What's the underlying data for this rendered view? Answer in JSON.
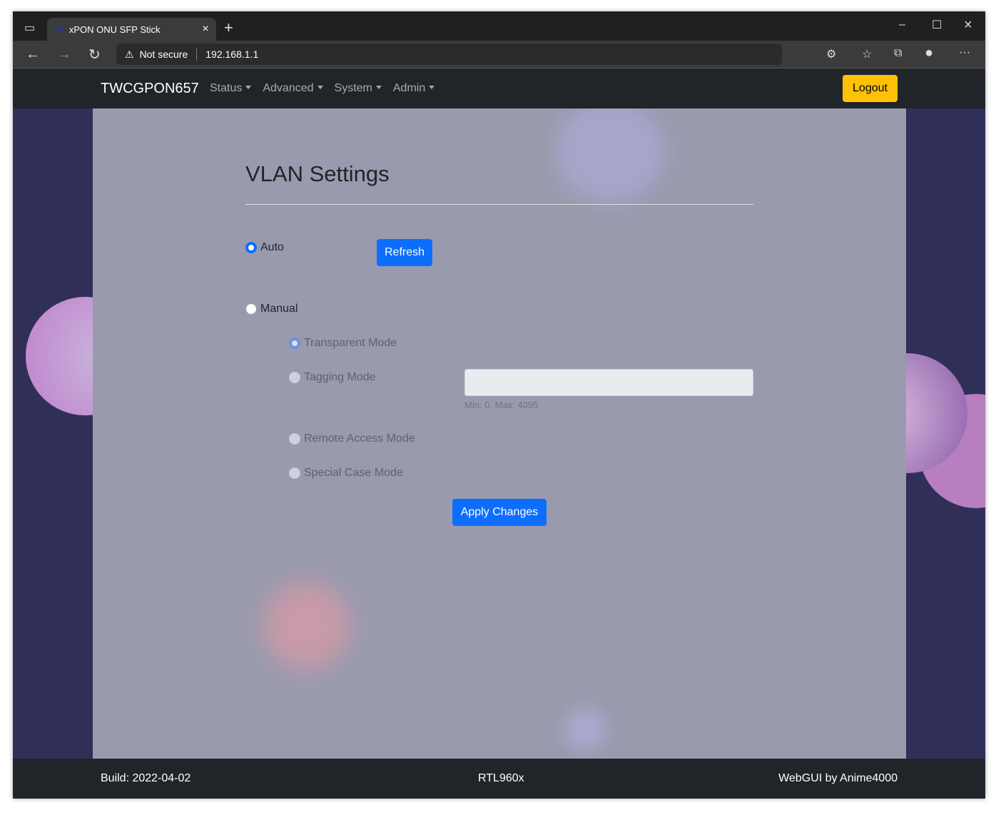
{
  "browser": {
    "tab_title": "xPON ONU SFP Stick",
    "security": "Not secure",
    "url": "192.168.1.1"
  },
  "navbar": {
    "brand": "TWCGPON657",
    "menus": [
      "Status",
      "Advanced",
      "System",
      "Admin"
    ],
    "logout": "Logout"
  },
  "page": {
    "title": "VLAN Settings",
    "auto": {
      "label": "Auto",
      "checked": true
    },
    "refresh": "Refresh",
    "manual": {
      "label": "Manual",
      "checked": false
    },
    "modes": [
      {
        "label": "Transparent Mode",
        "checked": true
      },
      {
        "label": "Tagging Mode",
        "checked": false
      },
      {
        "label": "Remote Access Mode",
        "checked": false
      },
      {
        "label": "Special Case Mode",
        "checked": false
      }
    ],
    "vlan_input": {
      "value": "",
      "help": "Min: 0, Max: 4095"
    },
    "apply": "Apply Changes"
  },
  "footer": {
    "build": "Build: 2022-04-02",
    "chip": "RTL960x",
    "credit": "WebGUI by Anime4000"
  },
  "colors": {
    "primary": "#0d6efd",
    "warning": "#ffc107",
    "navbar": "#212529"
  }
}
